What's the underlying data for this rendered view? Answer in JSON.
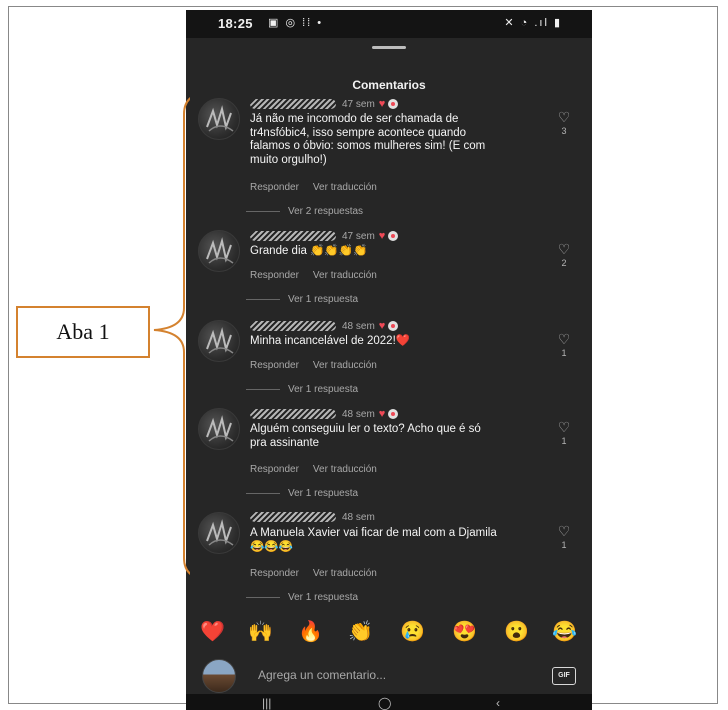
{
  "status_bar": {
    "time": "18:25",
    "left_icons": "▣ ◎ ⁞⁞ •",
    "right_icons": "✕ ◔ .ıl ▮"
  },
  "sheet": {
    "title": "Comentarios"
  },
  "comments": [
    {
      "time": "47 sem",
      "text": "Já não me incomodo de ser chamada de tr4nsfóbic4, isso sempre acontece quando falamos o óbvio: somos mulheres sim! (E com muito orgulho!)",
      "reply_label": "Responder",
      "translate_label": "Ver traducción",
      "view_replies": "Ver 2 respuestas",
      "likes": "3"
    },
    {
      "time": "47 sem",
      "text": "Grande dia 👏👏👏👏",
      "reply_label": "Responder",
      "translate_label": "Ver traducción",
      "view_replies": "Ver 1 respuesta",
      "likes": "2"
    },
    {
      "time": "48 sem",
      "text": "Minha incancelável de 2022!❤️",
      "reply_label": "Responder",
      "translate_label": "Ver traducción",
      "view_replies": "Ver 1 respuesta",
      "likes": "1"
    },
    {
      "time": "48 sem",
      "text": "Alguém conseguiu ler o texto? Acho que é só pra assinante",
      "reply_label": "Responder",
      "translate_label": "Ver traducción",
      "view_replies": "Ver 1 respuesta",
      "likes": "1"
    },
    {
      "time": "48 sem",
      "text": "A Manuela Xavier vai ficar de mal com a Djamila 😂😂😂",
      "reply_label": "Responder",
      "translate_label": "Ver traducción",
      "view_replies": "Ver 1 respuesta",
      "likes": "1"
    }
  ],
  "reactions": [
    "❤️",
    "🙌",
    "🔥",
    "👏",
    "😢",
    "😍",
    "😮",
    "😂"
  ],
  "composer": {
    "placeholder": "Agrega un comentario...",
    "gif_label": "GIF"
  },
  "nav": {
    "recents": "|||",
    "home": "◯",
    "back": "‹"
  },
  "annotation": {
    "label": "Aba 1",
    "color": "#d4822f"
  }
}
